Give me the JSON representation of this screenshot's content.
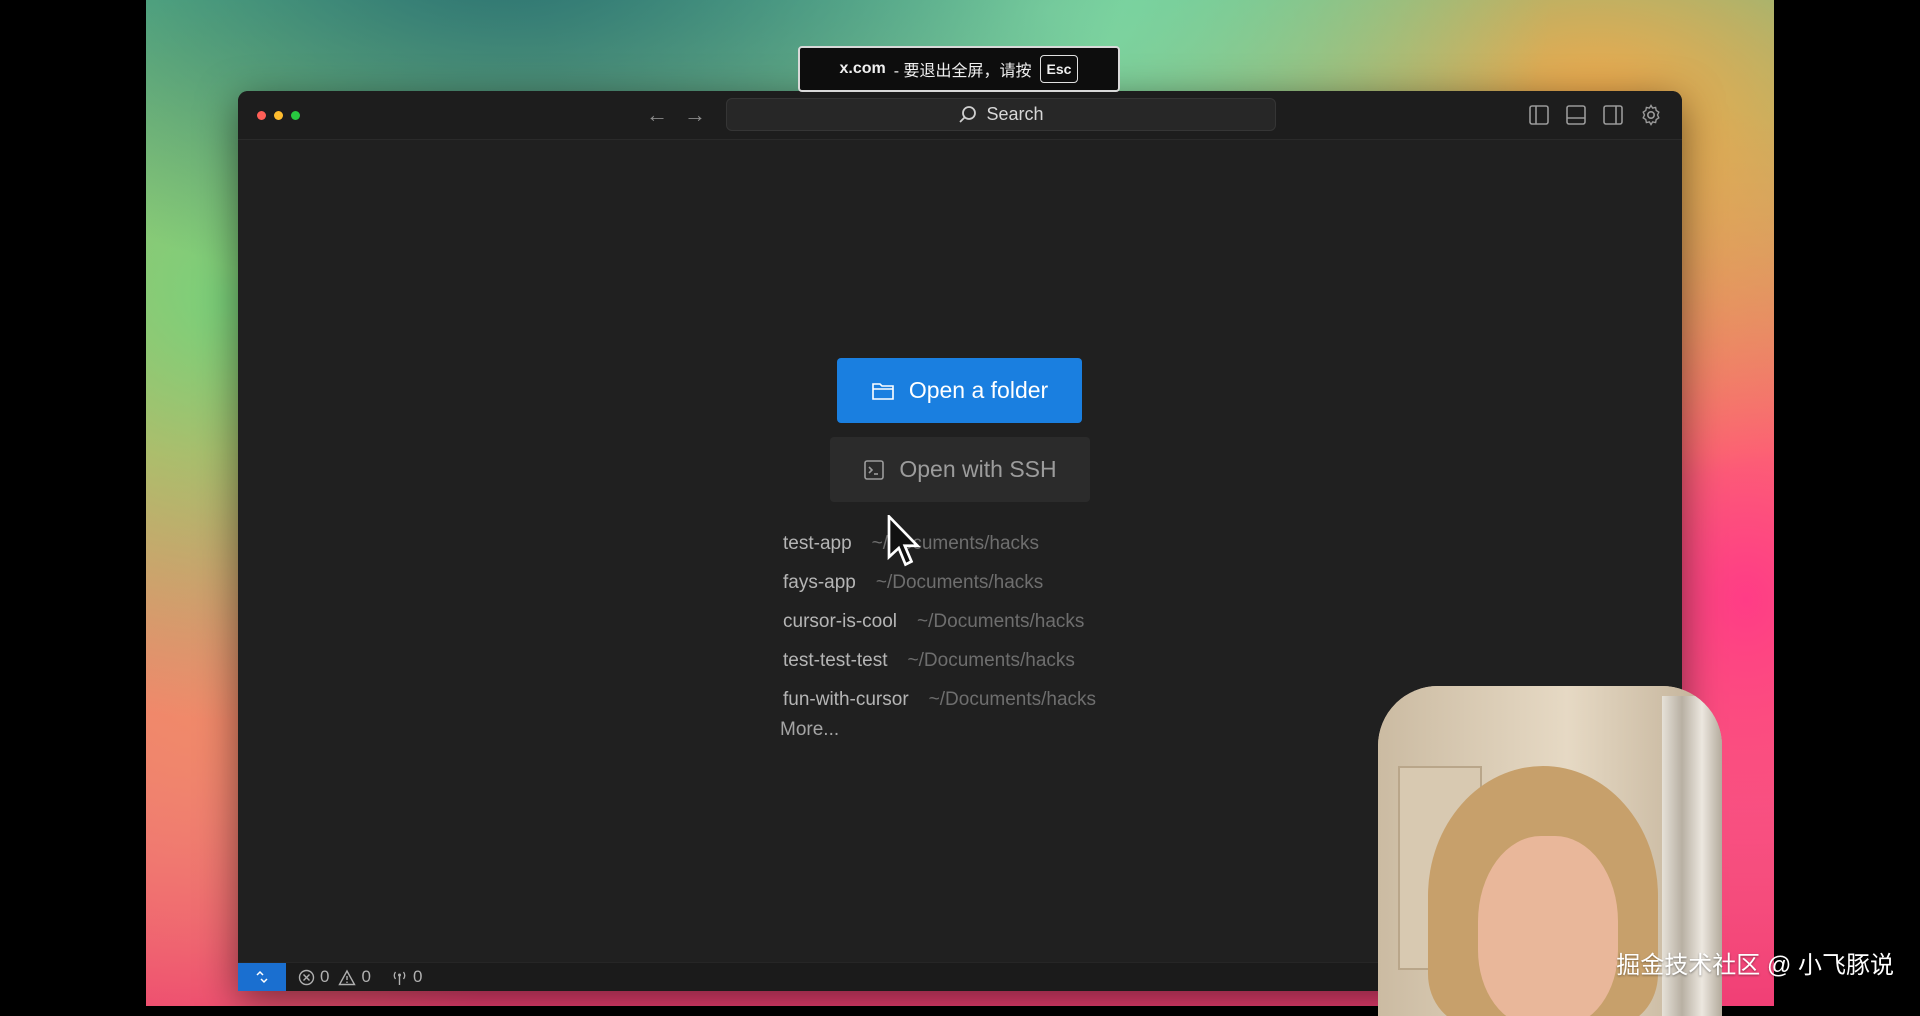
{
  "banner": {
    "site": "x.com",
    "message": "- 要退出全屏，请按",
    "key": "Esc"
  },
  "titlebar": {
    "search_label": "Search",
    "icons": [
      "back-arrow-icon",
      "forward-arrow-icon",
      "search-icon",
      "toggle-primary-sidebar-icon",
      "toggle-panel-icon",
      "toggle-secondary-sidebar-icon",
      "settings-gear-icon"
    ]
  },
  "welcome": {
    "open_folder_label": "Open a folder",
    "open_ssh_label": "Open with SSH",
    "recent": [
      {
        "name": "test-app",
        "path": "~/Documents/hacks"
      },
      {
        "name": "fays-app",
        "path": "~/Documents/hacks"
      },
      {
        "name": "cursor-is-cool",
        "path": "~/Documents/hacks"
      },
      {
        "name": "test-test-test",
        "path": "~/Documents/hacks"
      },
      {
        "name": "fun-with-cursor",
        "path": "~/Documents/hacks"
      }
    ],
    "more_label": "More..."
  },
  "statusbar": {
    "errors": "0",
    "warnings": "0",
    "ports": "0"
  },
  "watermark": "掘金技术社区 @ 小飞豚说",
  "colors": {
    "accent": "#1a7fe0",
    "window_bg": "#202020",
    "titlebar_bg": "#1d1d1d"
  }
}
